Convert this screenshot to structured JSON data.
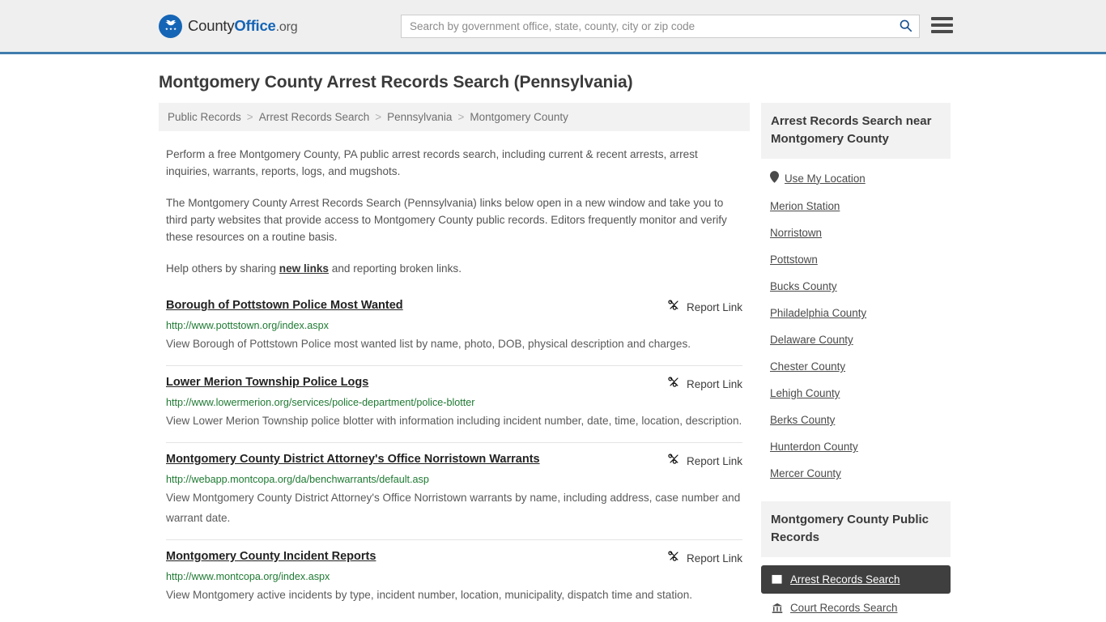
{
  "header": {
    "logo": {
      "part1": "County",
      "part2": "Office",
      "part3": ".org",
      "icon": "eagle-seal-icon"
    },
    "search": {
      "placeholder": "Search by government office, state, county, city or zip code",
      "value": "",
      "button_icon": "search-icon"
    },
    "menu_icon": "hamburger-menu-icon",
    "accent_color": "#3f7cac"
  },
  "page_title": "Montgomery County Arrest Records Search (Pennsylvania)",
  "breadcrumb": {
    "separator": ">",
    "items": [
      {
        "label": "Public Records",
        "current": false
      },
      {
        "label": "Arrest Records Search",
        "current": false
      },
      {
        "label": "Pennsylvania",
        "current": false
      },
      {
        "label": "Montgomery County",
        "current": true
      }
    ]
  },
  "intro": {
    "p1": "Perform a free Montgomery County, PA public arrest records search, including current & recent arrests, arrest inquiries, warrants, reports, logs, and mugshots.",
    "p2": "The Montgomery County Arrest Records Search (Pennsylvania) links below open in a new window and take you to third party websites that provide access to Montgomery County public records. Editors frequently monitor and verify these resources on a routine basis.",
    "p3_before": "Help others by sharing ",
    "p3_link": "new links",
    "p3_after": " and reporting broken links."
  },
  "results": {
    "report_link_label": "Report Link",
    "report_link_icon": "broken-link-icon",
    "items": [
      {
        "title": "Borough of Pottstown Police Most Wanted",
        "url": "http://www.pottstown.org/index.aspx",
        "description": "View Borough of Pottstown Police most wanted list by name, photo, DOB, physical description and charges."
      },
      {
        "title": "Lower Merion Township Police Logs",
        "url": "http://www.lowermerion.org/services/police-department/police-blotter",
        "description": "View Lower Merion Township police blotter with information including incident number, date, time, location, description."
      },
      {
        "title": "Montgomery County District Attorney's Office Norristown Warrants",
        "url": "http://webapp.montcopa.org/da/benchwarrants/default.asp",
        "description": "View Montgomery County District Attorney's Office Norristown warrants by name, including address, case number and warrant date."
      },
      {
        "title": "Montgomery County Incident Reports",
        "url": "http://www.montcopa.org/index.aspx",
        "description": "View Montgomery active incidents by type, incident number, location, municipality, dispatch time and station."
      }
    ]
  },
  "sidebar": {
    "nearby": {
      "heading": "Arrest Records Search near Montgomery County",
      "use_my_location": {
        "label": "Use My Location",
        "icon": "map-pin-icon"
      },
      "items": [
        {
          "label": "Merion Station"
        },
        {
          "label": "Norristown"
        },
        {
          "label": "Pottstown"
        },
        {
          "label": "Bucks County"
        },
        {
          "label": "Philadelphia County"
        },
        {
          "label": "Delaware County"
        },
        {
          "label": "Chester County"
        },
        {
          "label": "Lehigh County"
        },
        {
          "label": "Berks County"
        },
        {
          "label": "Hunterdon County"
        },
        {
          "label": "Mercer County"
        }
      ]
    },
    "public_records": {
      "heading": "Montgomery County Public Records",
      "items": [
        {
          "label": "Arrest Records Search",
          "icon": "document-icon",
          "active": true
        },
        {
          "label": "Court Records Search",
          "icon": "courthouse-icon",
          "active": false
        }
      ]
    }
  }
}
